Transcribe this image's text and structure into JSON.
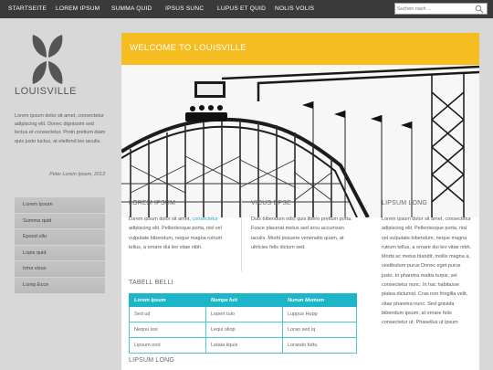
{
  "nav": {
    "items": [
      "STARTSEITE",
      "LOREM IPSUM",
      "SUMMA QUID",
      "IPSUS SUNC",
      "LUPUS ET QUID",
      "NOLIS VOLIS"
    ]
  },
  "search": {
    "placeholder": "Suchen nach ..."
  },
  "logo": {
    "text": "LOUISVILLE"
  },
  "sidebar": {
    "intro": "Lorem ipsum dolor sit amet, consectetur adipiscing elit. Donec dignissim sed lectus et consectetur. Proin pretium diam quis justo luctus, at eleifend leo iaculis.",
    "quote_author": "Peter Lorem Ipsum, 2013",
    "menu": [
      "Lorem Ipsum",
      "Summa quid",
      "Epsod ullu",
      "Lopis quid",
      "Irma visus",
      "Lorep Ecce"
    ]
  },
  "banner": {
    "title": "WELCOME TO LOUISVILLE"
  },
  "col1": {
    "heading": "LOREM IPSUM",
    "text_before": "Lorem ipsum dolor sit amet, ",
    "link": "consectetur",
    "text_after": " adipiscing elit. Pellentesque porta, nisl vel vulputate bibendum, neque magna rutrum tellus, a ornare dui leo vitae nibh."
  },
  "col2": {
    "heading": "VICUS EPSE",
    "text": "Duis bibendum odio quis libero pretium porta. Fusce placerat metus sed arcu accumsan iaculis. Morbi posuere venenatis quam, at ultricies felis dictum sed."
  },
  "col3": {
    "heading": "LIPSUM LONG",
    "text": "Lorem ipsum dolor sit amet, consectetur adipiscing elit. Pellentesque porta, nisl vel vulputate bibendum, neque magna rutrum tellus, a ornare dui leo vitae nibh. Morbi ac metus blandit, mollis magna a, vestibulum purus Donec eget purus justo. In pharetra mattis turpis, vel consectetur nunc. In hac habitasse platea dictumst. Cras non fringilla velit, vitae pharetra nunc. Sed gravida bibendum ipsum, at ornare felis consectetur ut. Phasellus ut ipsum"
  },
  "table_section": {
    "heading": "TABELL BELLI"
  },
  "table": {
    "headers": [
      "Lorem Ipsum",
      "Numpe futt",
      "Nunun Mumum"
    ],
    "rows": [
      [
        "Sed ud",
        "Lopert tuio",
        "Luppus Hupp"
      ],
      [
        "Nequu issi",
        "Lequi ollop",
        "Loran sed iq"
      ],
      [
        "Lipsum orot",
        "Letata iiquis",
        "Lorando futtu"
      ]
    ]
  },
  "bottom": {
    "heading": "LIPSUM LONG"
  },
  "colors": {
    "topbar": "#3a3a3a",
    "banner": "#f5bd1f",
    "table_header": "#1cb6c8",
    "link": "#1fa7c0"
  }
}
